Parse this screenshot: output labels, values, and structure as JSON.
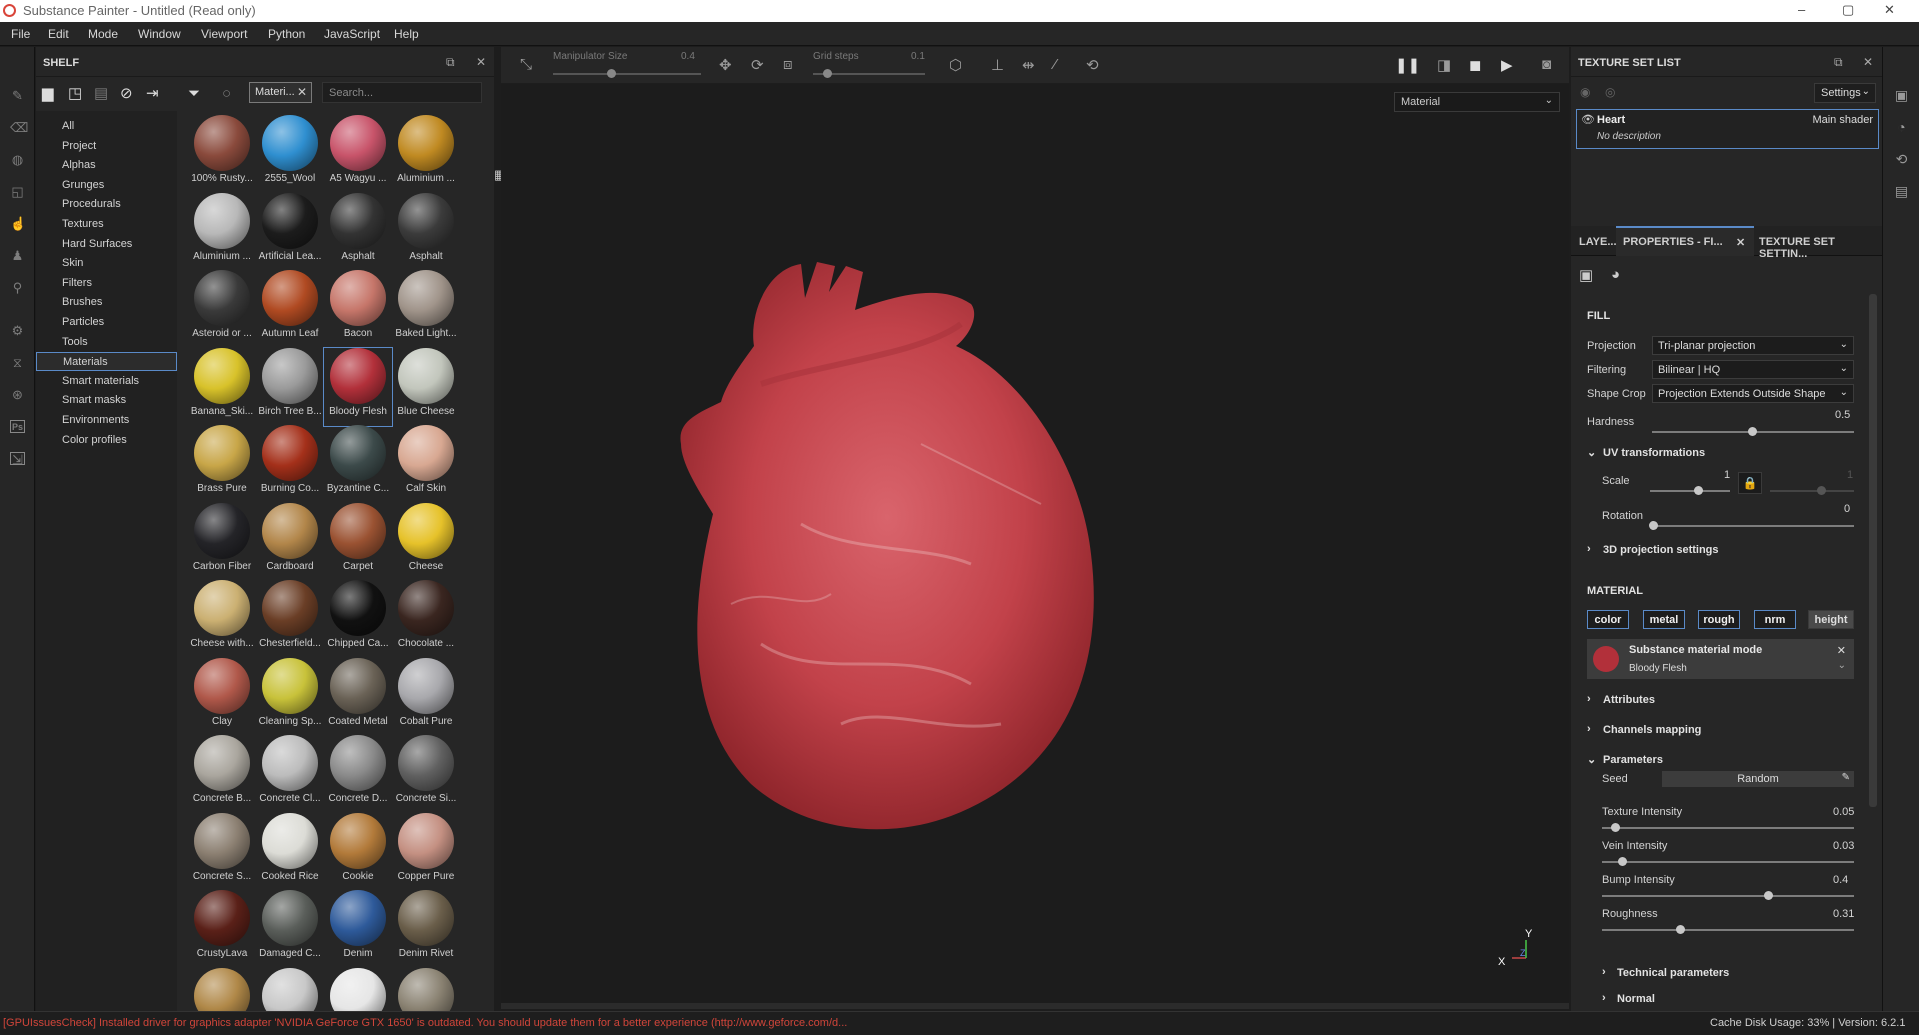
{
  "window": {
    "title": "Substance Painter - Untitled (Read only)",
    "min": "–",
    "max": "▢",
    "close": "✕"
  },
  "menu": [
    "File",
    "Edit",
    "Mode",
    "Window",
    "Viewport",
    "Python",
    "JavaScript",
    "Help"
  ],
  "left_tools": [
    "brush-icon",
    "eraser-icon",
    "projection-icon",
    "polygon-fill-icon",
    "smudge-icon",
    "clone-icon",
    "color-picker-icon",
    "settings-icon",
    "bake-icon",
    "layer-icon",
    "photoshop-icon",
    "export-icon"
  ],
  "shelf": {
    "title": "SHELF",
    "filter_chip": "Materi...",
    "search_placeholder": "Search...",
    "categories": [
      "All",
      "Project",
      "Alphas",
      "Grunges",
      "Procedurals",
      "Textures",
      "Hard Surfaces",
      "Skin",
      "Filters",
      "Brushes",
      "Particles",
      "Tools",
      "Materials",
      "Smart materials",
      "Smart masks",
      "Environments",
      "Color profiles"
    ],
    "selected_category": "Materials",
    "materials": [
      {
        "label": "100% Rusty...",
        "color": "#8a4a3c"
      },
      {
        "label": "2555_Wool",
        "color": "#2f8fd0"
      },
      {
        "label": "A5 Wagyu ...",
        "color": "#c8546a"
      },
      {
        "label": "Aluminium ...",
        "color": "#c08a22"
      },
      {
        "label": "Aluminium ...",
        "color": "#b8b8b8"
      },
      {
        "label": "Artificial Lea...",
        "color": "#1c1c1c"
      },
      {
        "label": "Asphalt",
        "color": "#333333"
      },
      {
        "label": "Asphalt",
        "color": "#3b3b3b"
      },
      {
        "label": "Asteroid or ...",
        "color": "#3a3a3a"
      },
      {
        "label": "Autumn Leaf",
        "color": "#b04a22"
      },
      {
        "label": "Bacon",
        "color": "#c6766a"
      },
      {
        "label": "Baked Light...",
        "color": "#a0948a"
      },
      {
        "label": "Banana_Ski...",
        "color": "#d8c22a"
      },
      {
        "label": "Birch Tree B...",
        "color": "#9a9a9a"
      },
      {
        "label": "Bloody Flesh",
        "color": "#b2303a"
      },
      {
        "label": "Blue Cheese",
        "color": "#c2c6bc"
      },
      {
        "label": "Brass Pure",
        "color": "#c8a648"
      },
      {
        "label": "Burning Co...",
        "color": "#a4301a"
      },
      {
        "label": "Byzantine C...",
        "color": "#3c4a4a"
      },
      {
        "label": "Calf Skin",
        "color": "#d8a892"
      },
      {
        "label": "Carbon Fiber",
        "color": "#242428"
      },
      {
        "label": "Cardboard",
        "color": "#b2864a"
      },
      {
        "label": "Carpet",
        "color": "#9a5232"
      },
      {
        "label": "Cheese",
        "color": "#e6c22a"
      },
      {
        "label": "Cheese with...",
        "color": "#cbb072"
      },
      {
        "label": "Chesterfield...",
        "color": "#6a3e26"
      },
      {
        "label": "Chipped Ca...",
        "color": "#111111"
      },
      {
        "label": "Chocolate ...",
        "color": "#3a2620"
      },
      {
        "label": "Clay",
        "color": "#b0584a"
      },
      {
        "label": "Cleaning Sp...",
        "color": "#c8c23a"
      },
      {
        "label": "Coated Metal",
        "color": "#6a6256"
      },
      {
        "label": "Cobalt Pure",
        "color": "#a8a8ac"
      },
      {
        "label": "Concrete B...",
        "color": "#aaa69e"
      },
      {
        "label": "Concrete Cl...",
        "color": "#bcbcbc"
      },
      {
        "label": "Concrete D...",
        "color": "#8a8a8a"
      },
      {
        "label": "Concrete Si...",
        "color": "#606060"
      },
      {
        "label": "Concrete S...",
        "color": "#8c8072"
      },
      {
        "label": "Cooked Rice",
        "color": "#dcdcd6"
      },
      {
        "label": "Cookie",
        "color": "#b27a3a"
      },
      {
        "label": "Copper Pure",
        "color": "#c49082"
      },
      {
        "label": "CrustyLava",
        "color": "#5a2018"
      },
      {
        "label": "Damaged C...",
        "color": "#5a5e5a"
      },
      {
        "label": "Denim",
        "color": "#2e5a9a"
      },
      {
        "label": "Denim Rivet",
        "color": "#6a5e4a"
      },
      {
        "label": "",
        "color": "#b08848"
      },
      {
        "label": "",
        "color": "#c8c8c8"
      },
      {
        "label": "",
        "color": "#e6e6e6"
      },
      {
        "label": "",
        "color": "#8a8272"
      }
    ]
  },
  "toolbar": {
    "manipulator_label": "Manipulator Size",
    "manipulator_value": "0.4",
    "grid_label": "Grid steps",
    "grid_value": "0.1",
    "material_mode": "Material"
  },
  "axis": {
    "x": "X",
    "y": "Y",
    "z": "Z"
  },
  "texture_set_list": {
    "title": "TEXTURE SET LIST",
    "settings": "Settings",
    "set_name": "Heart",
    "shader": "Main shader",
    "description": "No description"
  },
  "properties": {
    "tabs": [
      "LAYE...",
      "PROPERTIES - FI...",
      "TEXTURE SET SETTIN..."
    ],
    "fill_title": "FILL",
    "projection_label": "Projection",
    "projection_value": "Tri-planar projection",
    "filtering_label": "Filtering",
    "filtering_value": "Bilinear | HQ",
    "shape_crop_label": "Shape Crop",
    "shape_crop_value": "Projection Extends Outside Shape",
    "hardness_label": "Hardness",
    "hardness_value": "0.5",
    "uv_title": "UV transformations",
    "scale_label": "Scale",
    "scale_value": "1",
    "scale_value2": "1",
    "rotation_label": "Rotation",
    "rotation_value": "0",
    "proj3d": "3D projection settings",
    "material_title": "MATERIAL",
    "channels": [
      "color",
      "metal",
      "rough",
      "nrm",
      "height"
    ],
    "mode_title": "Substance material mode",
    "mode_material": "Bloody Flesh",
    "attributes": "Attributes",
    "channels_mapping": "Channels mapping",
    "parameters": "Parameters",
    "seed_label": "Seed",
    "seed_value": "Random",
    "params": [
      {
        "label": "Texture Intensity",
        "value": "0.05",
        "level": 0.05
      },
      {
        "label": "Vein Intensity",
        "value": "0.03",
        "level": 0.08
      },
      {
        "label": "Bump Intensity",
        "value": "0.4",
        "level": 0.66
      },
      {
        "label": "Roughness",
        "value": "0.31",
        "level": 0.31
      }
    ],
    "technical": "Technical parameters",
    "normal": "Normal"
  },
  "status": {
    "error": "[GPUIssuesCheck] Installed driver for graphics adapter 'NVIDIA GeForce GTX 1650' is outdated. You should update them for a better experience (http://www.geforce.com/d...",
    "cache": "Cache Disk Usage:    33% | Version: 6.2.1"
  }
}
